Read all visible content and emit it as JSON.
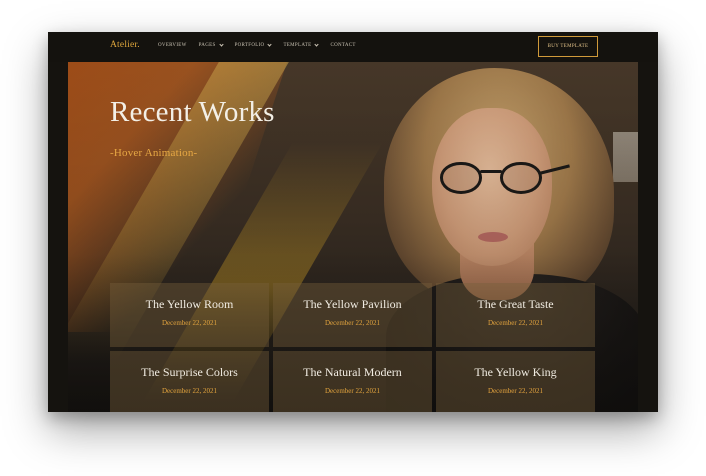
{
  "brand": {
    "logo": "Atelier."
  },
  "nav": [
    {
      "label": "OVERVIEW",
      "dropdown": false
    },
    {
      "label": "PAGES",
      "dropdown": true
    },
    {
      "label": "PORTFOLIO",
      "dropdown": true
    },
    {
      "label": "TEMPLATE",
      "dropdown": true
    },
    {
      "label": "CONTACT",
      "dropdown": false
    }
  ],
  "header": {
    "cta_label": "BUY TEMPLATE"
  },
  "hero": {
    "title": "Recent Works",
    "subtitle": "-Hover Animation-"
  },
  "works": [
    {
      "title": "The Yellow Room",
      "date": "December 22, 2021"
    },
    {
      "title": "The Yellow Pavilion",
      "date": "December 22, 2021"
    },
    {
      "title": "The Great Taste",
      "date": "December 22, 2021"
    },
    {
      "title": "The Surprise Colors",
      "date": "December 22, 2021"
    },
    {
      "title": "The Natural Modern",
      "date": "December 22, 2021"
    },
    {
      "title": "The Yellow King",
      "date": "December 22, 2021"
    }
  ],
  "colors": {
    "accent": "#e3a43e",
    "background": "#15130f",
    "card": "#785f3c"
  }
}
